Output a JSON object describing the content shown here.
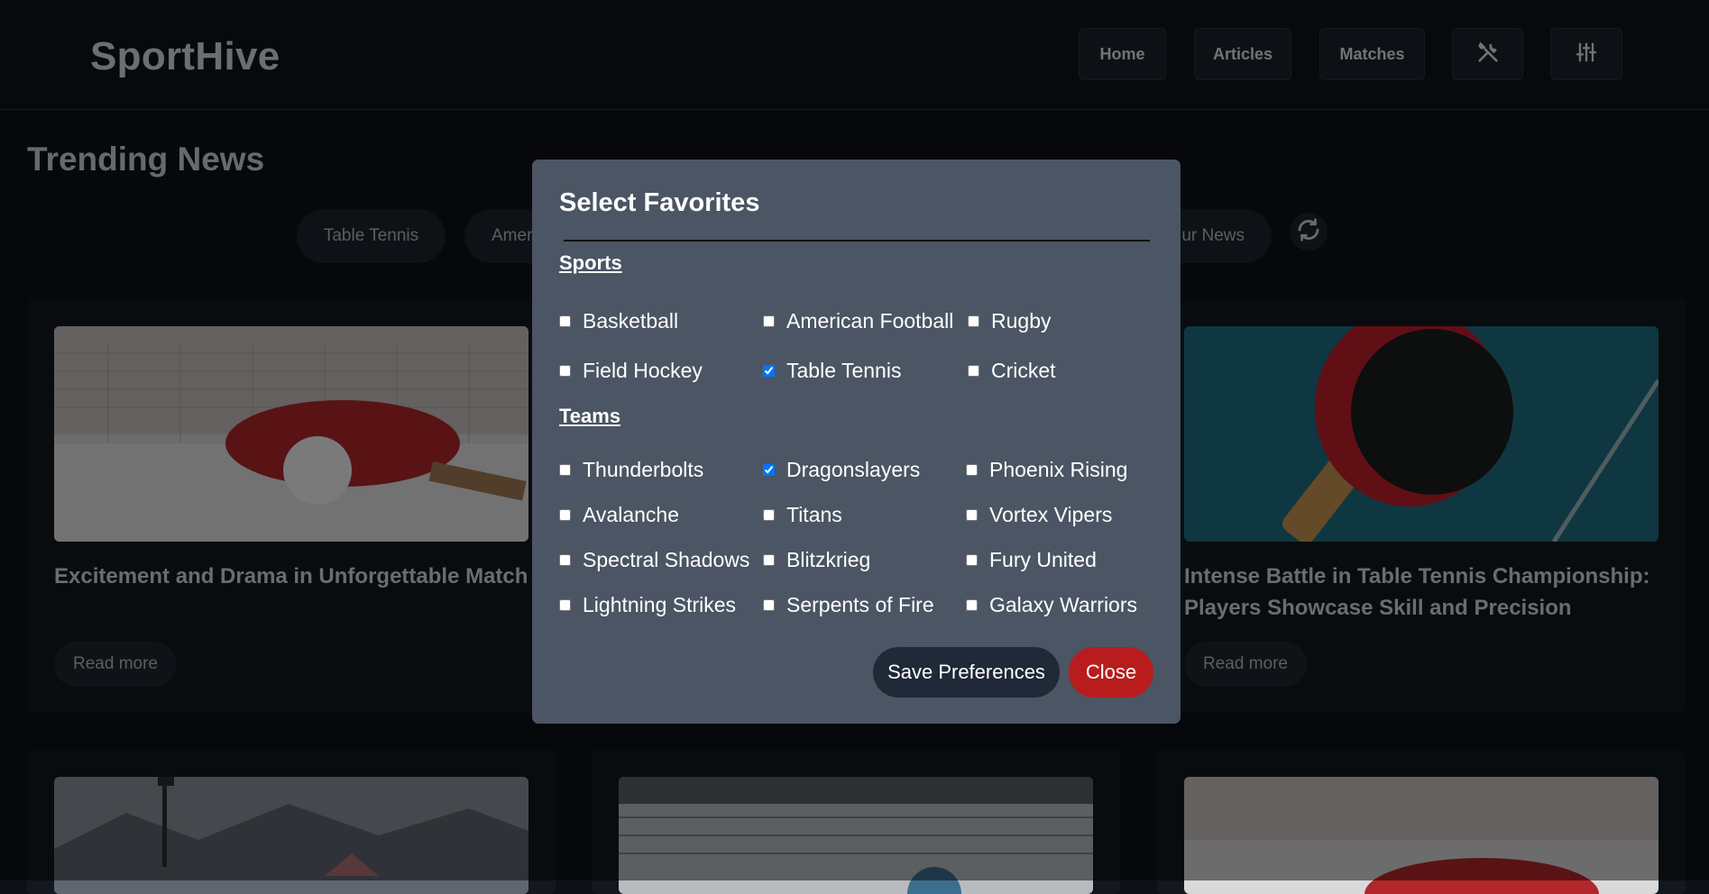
{
  "header": {
    "logo": "SportHive",
    "nav": [
      "Home",
      "Articles",
      "Matches"
    ],
    "tools_icon": "tools-icon",
    "settings_icon": "sliders-icon"
  },
  "main": {
    "title": "Trending News",
    "filters": [
      "Table Tennis",
      "Amer",
      "ur News"
    ],
    "refresh_icon": "refresh-icon",
    "cards": [
      {
        "title": "Excitement and Drama in Unforgettable Match",
        "read_more": "Read more"
      },
      {
        "title": "Intense Battle in Table Tennis Championship: Players Showcase Skill and Precision",
        "read_more": "Read more"
      }
    ]
  },
  "modal": {
    "title": "Select Favorites",
    "sports_label": "Sports",
    "sports": [
      {
        "label": "Basketball",
        "checked": false
      },
      {
        "label": "American Football",
        "checked": false
      },
      {
        "label": "Rugby",
        "checked": false
      },
      {
        "label": "Field Hockey",
        "checked": false
      },
      {
        "label": "Table Tennis",
        "checked": true
      },
      {
        "label": "Cricket",
        "checked": false
      }
    ],
    "teams_label": "Teams",
    "teams": [
      {
        "label": "Thunderbolts",
        "checked": false
      },
      {
        "label": "Dragonslayers",
        "checked": true
      },
      {
        "label": "Phoenix Rising",
        "checked": false
      },
      {
        "label": "Avalanche",
        "checked": false
      },
      {
        "label": "Titans",
        "checked": false
      },
      {
        "label": "Vortex Vipers",
        "checked": false
      },
      {
        "label": "Spectral Shadows",
        "checked": false
      },
      {
        "label": "Blitzkrieg",
        "checked": false
      },
      {
        "label": "Fury United",
        "checked": false
      },
      {
        "label": "Lightning Strikes",
        "checked": false
      },
      {
        "label": "Serpents of Fire",
        "checked": false
      },
      {
        "label": "Galaxy Warriors",
        "checked": false
      }
    ],
    "save_label": "Save Preferences",
    "close_label": "Close"
  },
  "colors": {
    "modal_bg": "#4b5563",
    "close_bg": "#b91c1c",
    "save_bg": "#1f2937",
    "page_bg": "#0d1117"
  }
}
